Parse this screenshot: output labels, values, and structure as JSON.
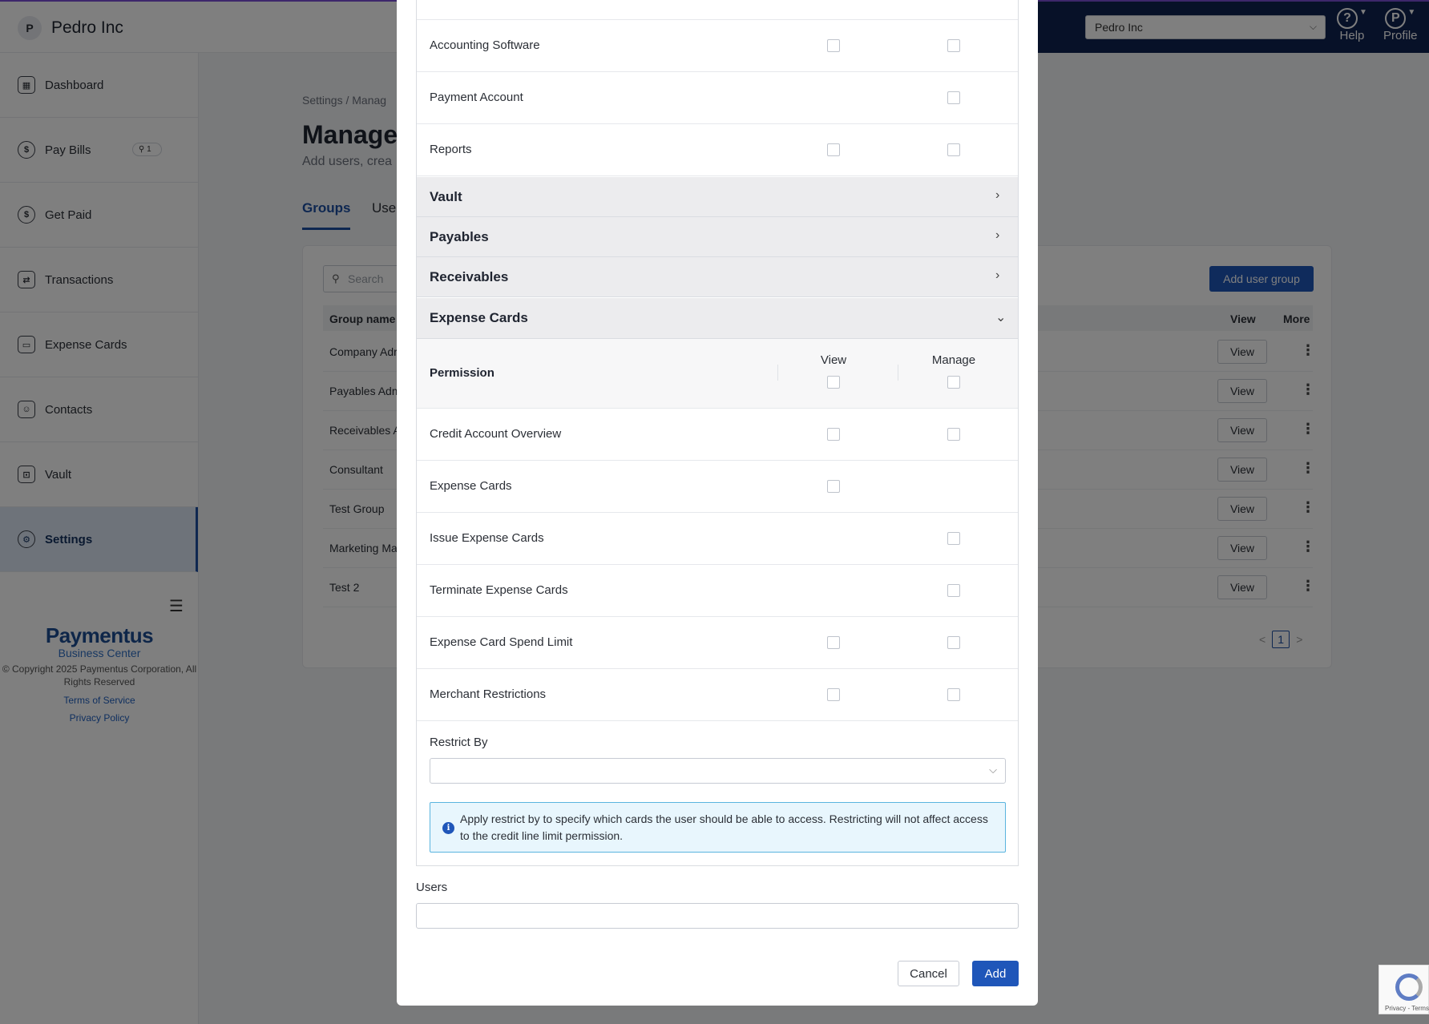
{
  "app": {
    "org_initial": "P",
    "org_name": "Pedro Inc",
    "org_selector_value": "Pedro Inc",
    "help_label": "Help",
    "profile_label": "Profile",
    "profile_initial": "P",
    "accent_color": "#1f56b9"
  },
  "sidebar": {
    "items": [
      {
        "label": "Dashboard",
        "icon": "dashboard-icon"
      },
      {
        "label": "Pay Bills",
        "icon": "pay-bills-icon",
        "badge": "1"
      },
      {
        "label": "Get Paid",
        "icon": "get-paid-icon"
      },
      {
        "label": "Transactions",
        "icon": "transactions-icon"
      },
      {
        "label": "Expense Cards",
        "icon": "card-icon"
      },
      {
        "label": "Contacts",
        "icon": "contacts-icon"
      },
      {
        "label": "Vault",
        "icon": "vault-icon"
      },
      {
        "label": "Settings",
        "icon": "gear-icon",
        "active": true
      }
    ],
    "footer": {
      "logo": "Paymentus",
      "logo_sub": "Business Center",
      "copyright": "© Copyright 2025 Paymentus Corporation, All Rights Reserved",
      "terms": "Terms of Service",
      "privacy": "Privacy Policy"
    }
  },
  "main": {
    "breadcrumb_root": "Settings",
    "breadcrumb_sep": "/",
    "breadcrumb_current": "Manag",
    "title": "Manage",
    "subtitle": "Add users, crea",
    "tabs": [
      "Groups",
      "Use"
    ],
    "search_placeholder": "Search",
    "add_group_label": "Add user group",
    "table": {
      "headers": {
        "name": "Group name",
        "view": "View",
        "more": "More"
      },
      "rows": [
        "Company Adr",
        "Payables Adm",
        "Receivables A",
        "Consultant",
        "Test Group",
        "Marketing Ma",
        "Test 2"
      ],
      "view_label": "View"
    },
    "pagination": {
      "prev": "<",
      "current": "1",
      "next": ">"
    }
  },
  "modal": {
    "top_permissions": [
      {
        "label": "Accounting Software",
        "view": true,
        "manage": true
      },
      {
        "label": "Payment Account",
        "view": false,
        "manage": true
      },
      {
        "label": "Reports",
        "view": true,
        "manage": true
      }
    ],
    "sections": [
      {
        "label": "Vault",
        "expanded": false
      },
      {
        "label": "Payables",
        "expanded": false
      },
      {
        "label": "Receivables",
        "expanded": false
      },
      {
        "label": "Expense Cards",
        "expanded": true
      }
    ],
    "permission_header": {
      "permission": "Permission",
      "view": "View",
      "manage": "Manage"
    },
    "expense_permissions": [
      {
        "label": "Credit Account Overview",
        "view": true,
        "manage": true
      },
      {
        "label": "Expense Cards",
        "view": true,
        "manage": false
      },
      {
        "label": "Issue Expense Cards",
        "view": false,
        "manage": true
      },
      {
        "label": "Terminate Expense Cards",
        "view": false,
        "manage": true
      },
      {
        "label": "Expense Card Spend Limit",
        "view": true,
        "manage": true
      },
      {
        "label": "Merchant Restrictions",
        "view": true,
        "manage": true
      }
    ],
    "restrict_by_label": "Restrict By",
    "restrict_by_value": "",
    "info_text": "Apply restrict by to specify which cards the user should be able to access. Restricting will not affect access to the credit line limit permission.",
    "users_label": "Users",
    "users_value": "",
    "cancel_label": "Cancel",
    "add_label": "Add"
  },
  "recaptcha": {
    "text": "Privacy - Terms"
  }
}
